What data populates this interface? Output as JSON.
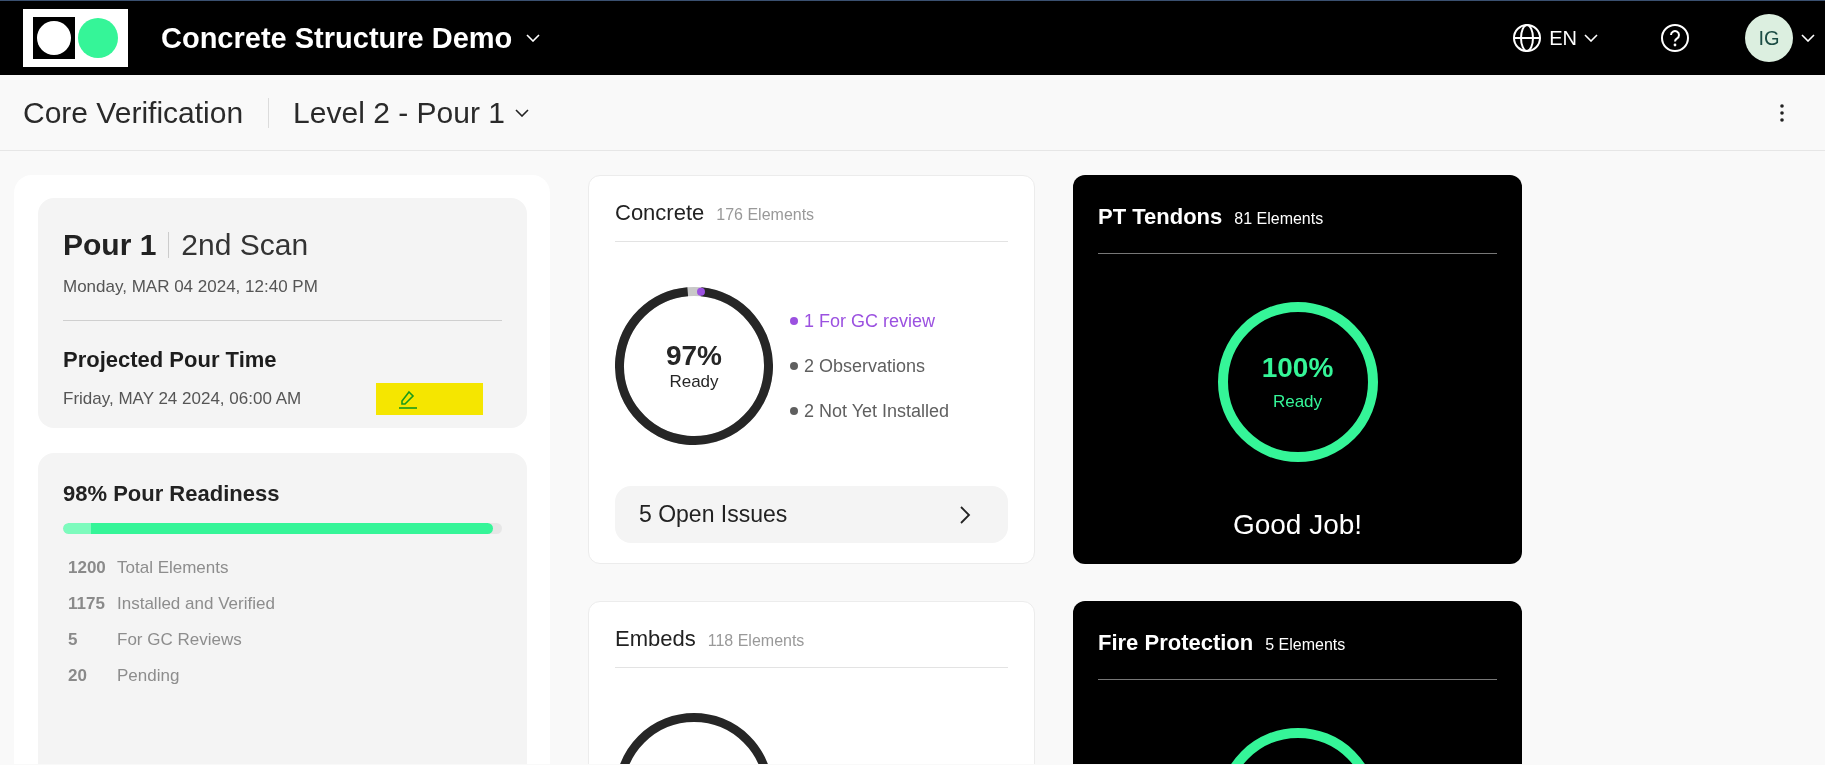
{
  "header": {
    "project_title": "Concrete Structure Demo",
    "language": "EN",
    "avatar_initials": "IG"
  },
  "subheader": {
    "title": "Core Verification",
    "pour_selector": "Level 2 - Pour 1"
  },
  "scan_card": {
    "pour": "Pour 1",
    "scan": "2nd Scan",
    "scan_date": "Monday, MAR 04 2024, 12:40 PM",
    "projected_label": "Projected Pour Time",
    "projected_date": "Friday, MAY 24 2024, 06:00 AM"
  },
  "readiness": {
    "title": "98% Pour Readiness",
    "level": 0.98,
    "stats": [
      {
        "count": "1200",
        "label": "Total Elements"
      },
      {
        "count": "1175",
        "label": "Installed and Verified"
      },
      {
        "count": "5",
        "label": "For GC Reviews"
      },
      {
        "count": "20",
        "label": "Pending"
      }
    ]
  },
  "category_cards": [
    {
      "kind": "light",
      "name": "Concrete",
      "count": "176 Elements",
      "ring": {
        "level": 0.97,
        "percent": "97%",
        "caption": "Ready"
      },
      "legend": [
        {
          "text": "1 For GC review",
          "color": "#9b51e0"
        },
        {
          "text": "2 Observations",
          "color": "#5f5f5f"
        },
        {
          "text": "2 Not Yet Installed",
          "color": "#5f5f5f"
        }
      ],
      "issues_button": "5 Open Issues"
    },
    {
      "kind": "dark",
      "name": "PT Tendons",
      "count": "81 Elements",
      "ring": {
        "level": 1,
        "percent": "100%",
        "caption": "Ready"
      },
      "message": "Good Job!"
    },
    {
      "kind": "light",
      "name": "Embeds",
      "count": "118 Elements"
    },
    {
      "kind": "dark",
      "name": "Fire Protection",
      "count": "5 Elements"
    }
  ]
}
